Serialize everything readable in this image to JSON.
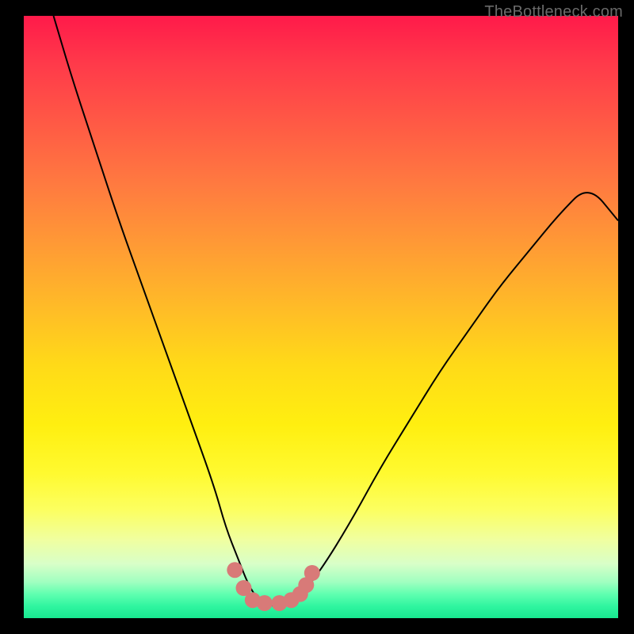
{
  "watermark": "TheBottleneck.com",
  "chart_data": {
    "type": "line",
    "title": "",
    "xlabel": "",
    "ylabel": "",
    "xlim": [
      0,
      100
    ],
    "ylim": [
      0,
      100
    ],
    "series": [
      {
        "name": "bottleneck-curve",
        "x": [
          5,
          8,
          12,
          16,
          20,
          24,
          28,
          32,
          34,
          36,
          38,
          40,
          42,
          44,
          46,
          50,
          55,
          60,
          65,
          70,
          75,
          80,
          85,
          90,
          95,
          100
        ],
        "values": [
          100,
          90,
          78,
          66,
          55,
          44,
          33,
          22,
          15,
          10,
          5,
          2.5,
          2,
          2,
          3,
          8,
          16,
          25,
          33,
          41,
          48,
          55,
          61,
          67,
          72,
          66
        ]
      }
    ],
    "markers": {
      "name": "optimal-zone",
      "color": "#d87a78",
      "points_x": [
        35.5,
        37,
        38.5,
        40.5,
        43,
        45,
        46.5,
        47.5,
        48.5
      ],
      "points_y": [
        8,
        5,
        3,
        2.5,
        2.5,
        3,
        4,
        5.5,
        7.5
      ]
    },
    "gradient_stops": [
      {
        "pos": 0,
        "color": "#ff1a4a"
      },
      {
        "pos": 50,
        "color": "#ffda18"
      },
      {
        "pos": 85,
        "color": "#f0ffa0"
      },
      {
        "pos": 100,
        "color": "#18e890"
      }
    ]
  }
}
